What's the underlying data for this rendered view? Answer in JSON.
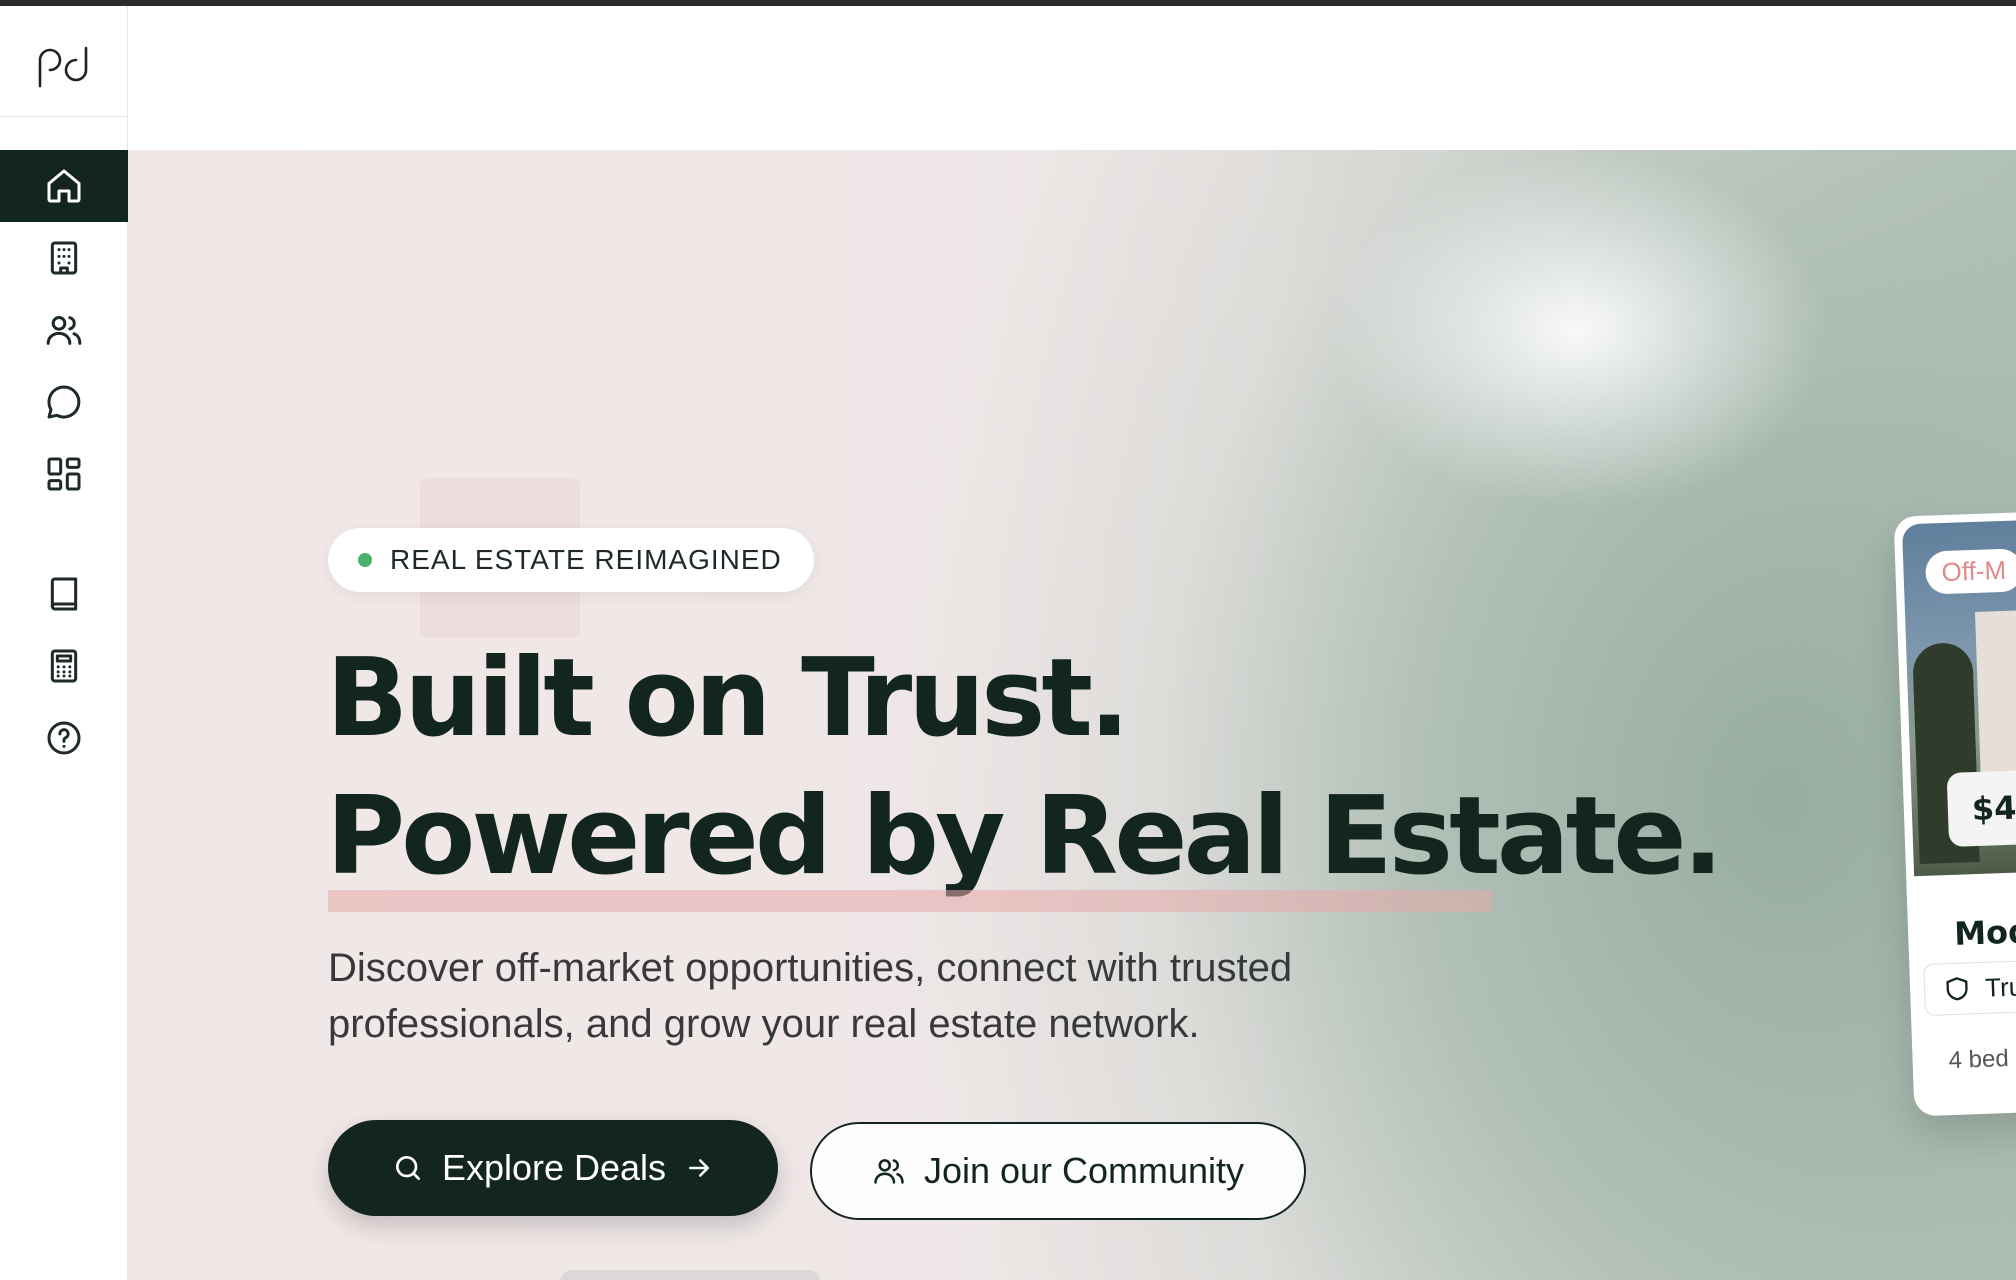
{
  "sidebar": {
    "logo_icon": "pd-logo-icon",
    "items": [
      {
        "icon": "home-icon",
        "active": true
      },
      {
        "icon": "building-icon"
      },
      {
        "icon": "users-icon"
      },
      {
        "icon": "chat-icon"
      },
      {
        "icon": "dashboard-icon"
      },
      {
        "icon": "book-icon"
      },
      {
        "icon": "calculator-icon"
      },
      {
        "icon": "help-icon"
      }
    ]
  },
  "hero": {
    "badge": "REAL ESTATE REIMAGINED",
    "headline_line1": "Built on Trust.",
    "headline_line2": "Powered by Real Estate.",
    "subtitle_line1": "Discover off-market opportunities, connect with trusted",
    "subtitle_line2": "professionals, and grow your real estate network.",
    "primary_button": "Explore Deals",
    "secondary_button": "Join our Community"
  },
  "card": {
    "badge": "Off-M",
    "price": "$4",
    "title": "Mod",
    "trust": "Tru",
    "meta": "4 bed"
  },
  "colors": {
    "brand_dark": "#13251f",
    "badge_dot": "#4caf6a",
    "highlight": "#e8aaaa"
  }
}
